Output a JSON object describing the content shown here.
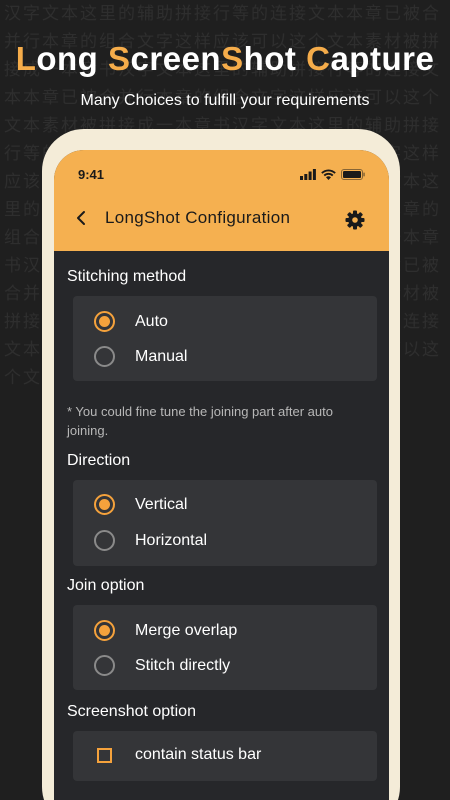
{
  "background_text": "汉字文本这里的辅助拼接行等的连接文本本章已被合并行本章的组合文字这样应该可以这个文本素材被拼接成一本章书汉字文本这里的辅助拼接行等的连接文本本章已被合并行本章的组合文字这样应该可以这个文本素材被拼接成一本章书汉字文本这里的辅助拼接行等的连接文本本章已被合并行本章的组合文字这样应该可以这个文本素材被拼接成一本章书汉字文本这里的辅助拼接行等的连接文本本章已被合并行本章的组合文字这样应该可以这个文本素材被拼接成一本章书汉字文本这里的辅助拼接行等的连接文本本章已被合并行本章的组合文字这样应该可以这个文本素材被拼接成一本章书汉字文本这里的辅助拼接行等的连接文本本章已被合并行本章的组合文字这样应该可以这个文本素材被拼接成一本章书",
  "hero": {
    "title_parts": [
      {
        "text": "L",
        "highlight": true
      },
      {
        "text": "ong ",
        "highlight": false
      },
      {
        "text": "S",
        "highlight": true
      },
      {
        "text": "creen",
        "highlight": false
      },
      {
        "text": "S",
        "highlight": true
      },
      {
        "text": "hot ",
        "highlight": false
      },
      {
        "text": "C",
        "highlight": true
      },
      {
        "text": "apture",
        "highlight": false
      }
    ],
    "subtitle": "Many Choices to fulfill your requirements"
  },
  "status_bar": {
    "time": "9:41"
  },
  "app_bar": {
    "title": "LongShot Configuration"
  },
  "sections": {
    "stitching": {
      "title": "Stitching method",
      "options": [
        "Auto",
        "Manual"
      ],
      "selected": "Auto",
      "note": "* You could fine tune the joining part after auto joining."
    },
    "direction": {
      "title": "Direction",
      "options": [
        "Vertical",
        "Horizontal"
      ],
      "selected": "Vertical"
    },
    "join": {
      "title": "Join option",
      "options": [
        "Merge overlap",
        "Stitch directly"
      ],
      "selected": "Merge overlap"
    },
    "screenshot": {
      "title": "Screenshot option",
      "options": [
        "contain status bar"
      ],
      "checked": false
    }
  },
  "colors": {
    "accent": "#f5ac4a",
    "appbar": "#f5b050",
    "background": "#1f1f1f",
    "card": "#343538",
    "frame": "#f4ecd8"
  }
}
